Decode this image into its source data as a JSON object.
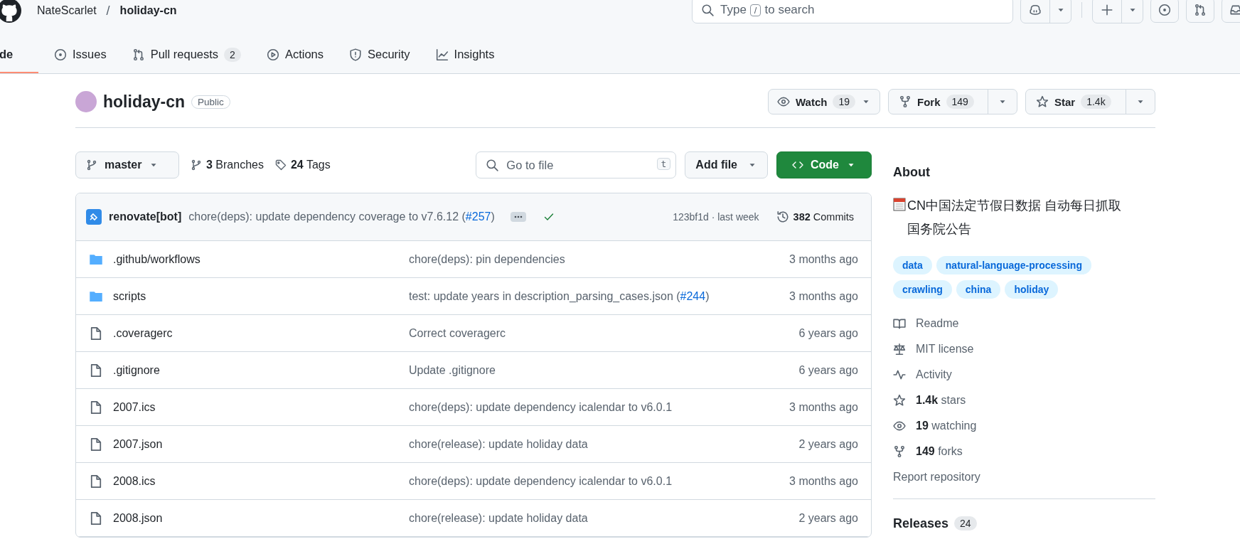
{
  "header": {
    "owner": "NateScarlet",
    "separator": "/",
    "repo": "holiday-cn",
    "search": {
      "before": "Type",
      "key": "/",
      "after": "to search"
    }
  },
  "nav_tabs": [
    {
      "kind": "code",
      "label": "de",
      "selected": true
    },
    {
      "kind": "issues",
      "label": "Issues",
      "selected": false
    },
    {
      "kind": "pulls",
      "label": "Pull requests",
      "count": "2",
      "selected": false
    },
    {
      "kind": "actions",
      "label": "Actions",
      "selected": false
    },
    {
      "kind": "security",
      "label": "Security",
      "selected": false
    },
    {
      "kind": "insights",
      "label": "Insights",
      "selected": false
    }
  ],
  "repo": {
    "name": "holiday-cn",
    "visibility": "Public",
    "actions": [
      {
        "kind": "watch",
        "label": "Watch",
        "count": "19"
      },
      {
        "kind": "fork",
        "label": "Fork",
        "count": "149"
      },
      {
        "kind": "star",
        "label": "Star",
        "count": "1.4k"
      }
    ]
  },
  "toolbar": {
    "branch": "master",
    "branches": "**3** Branches",
    "tags": "**24** Tags",
    "file_search": {
      "placeholder": "Go to file",
      "key": "t"
    },
    "add_file": "Add file",
    "code": "Code"
  },
  "latest_commit": {
    "author": "renovate[bot]",
    "message": "chore(deps): update dependency coverage to v7.6.12 (",
    "pr": "#257",
    "message_end": ")",
    "checks_passed": true,
    "hash_time": "123bf1d · last week",
    "commits": "**382** Commits"
  },
  "files": [
    {
      "kind": "folder",
      "name": ".github/workflows",
      "message": "chore(deps): pin dependencies",
      "time": "3 months ago"
    },
    {
      "kind": "folder",
      "name": "scripts",
      "message": "test: update years in description_parsing_cases.json (",
      "pr": "#244",
      "message_end": ")",
      "time": "3 months ago"
    },
    {
      "kind": "file",
      "name": ".coveragerc",
      "message": "Correct coveragerc",
      "time": "6 years ago"
    },
    {
      "kind": "file",
      "name": ".gitignore",
      "message": "Update .gitignore",
      "time": "6 years ago"
    },
    {
      "kind": "file",
      "name": "2007.ics",
      "message": "chore(deps): update dependency icalendar to v6.0.1",
      "time": "3 months ago"
    },
    {
      "kind": "file",
      "name": "2007.json",
      "message": "chore(release): update holiday data",
      "time": "2 years ago"
    },
    {
      "kind": "file",
      "name": "2008.ics",
      "message": "chore(deps): update dependency icalendar to v6.0.1",
      "time": "3 months ago"
    },
    {
      "kind": "file",
      "name": "2008.json",
      "message": "chore(release): update holiday data",
      "time": "2 years ago"
    }
  ],
  "about": {
    "title": "About",
    "description": "CN中国法定节假日数据 自动每日抓取国务院公告",
    "topics": [
      "data",
      "natural-language-processing",
      "crawling",
      "china",
      "holiday"
    ],
    "links": [
      {
        "kind": "readme",
        "label": "Readme"
      },
      {
        "kind": "license",
        "label": "MIT license"
      },
      {
        "kind": "activity",
        "label": "Activity"
      },
      {
        "kind": "stars",
        "label": "**1.4k** stars"
      },
      {
        "kind": "watching",
        "label": "**19** watching"
      },
      {
        "kind": "forks",
        "label": "**149** forks"
      },
      {
        "kind": "report",
        "label": "Report repository"
      }
    ],
    "releases": {
      "title": "Releases",
      "count": "24"
    }
  }
}
